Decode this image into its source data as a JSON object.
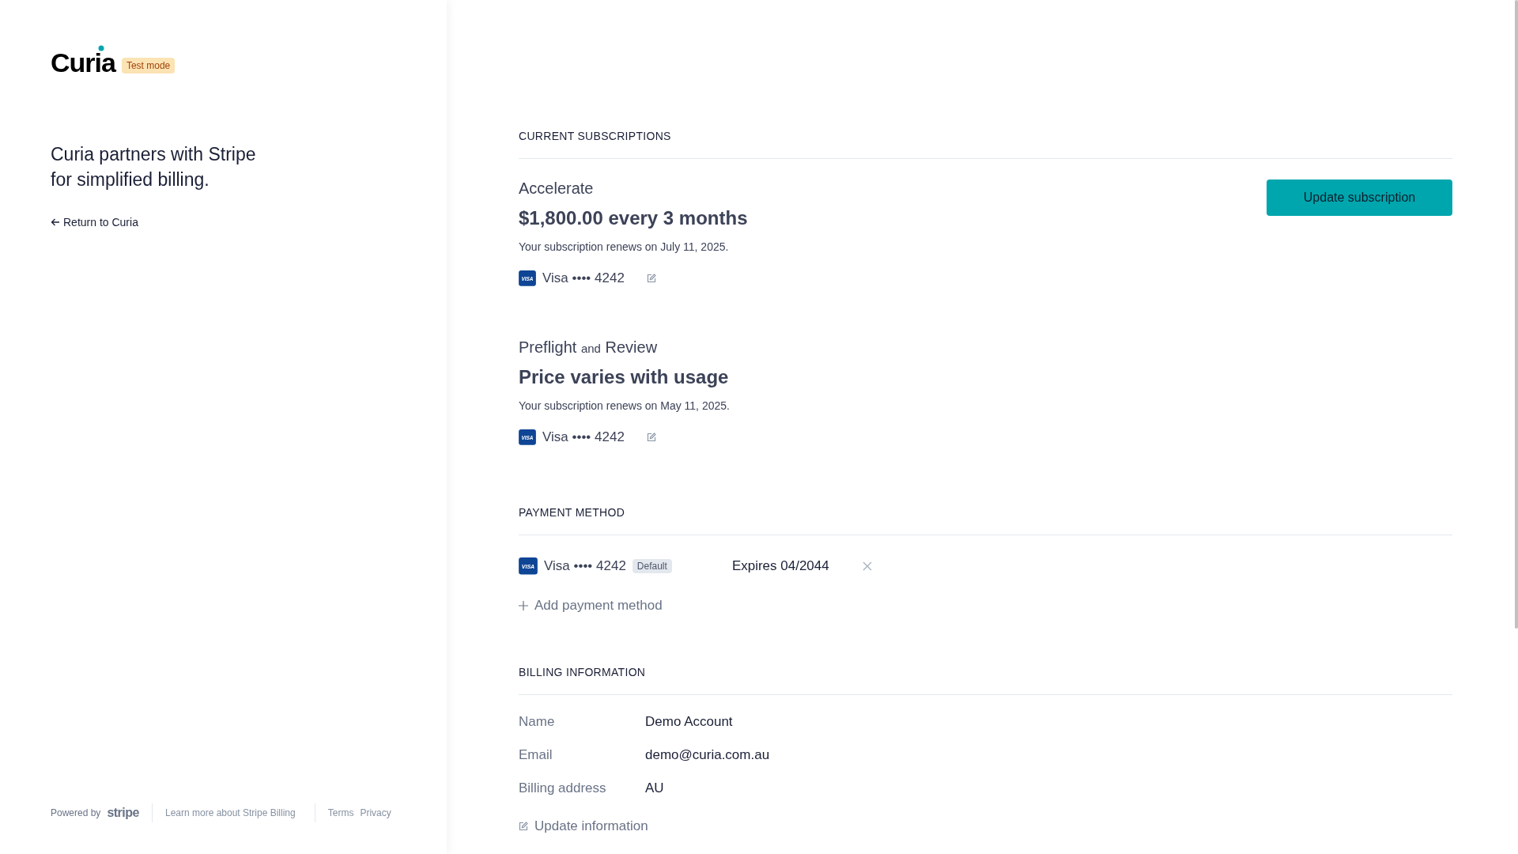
{
  "brand": {
    "logo": "Curia",
    "badge": "Test mode"
  },
  "tagline": "Curia partners with Stripe for simplified billing.",
  "return_link": "Return to Curia",
  "footer": {
    "powered_by": "Powered by",
    "stripe_logo": "stripe",
    "links": [
      "Learn more about Stripe Billing",
      "Terms",
      "Privacy"
    ]
  },
  "subscriptions": {
    "heading": "CURRENT SUBSCRIPTIONS",
    "update_button": "Update subscription",
    "items": [
      {
        "name_parts": [
          {
            "text": "Accelerate",
            "kind": "word"
          }
        ],
        "price": "$1,800.00 every 3 months",
        "renewal": "Your subscription renews on July 11, 2025.",
        "card": {
          "brand": "VISA",
          "label": "Visa •••• 4242"
        }
      },
      {
        "name_parts": [
          {
            "text": "Preflight",
            "kind": "word"
          },
          {
            "text": "and",
            "kind": "joiner"
          },
          {
            "text": "Review",
            "kind": "word"
          }
        ],
        "price": "Price varies with usage",
        "renewal": "Your subscription renews on May 11, 2025.",
        "card": {
          "brand": "VISA",
          "label": "Visa •••• 4242"
        }
      }
    ]
  },
  "payment_method": {
    "heading": "PAYMENT METHOD",
    "methods": [
      {
        "brand": "VISA",
        "label": "Visa •••• 4242",
        "default_badge": "Default",
        "expires": "Expires 04/2044"
      }
    ],
    "add": "Add payment method"
  },
  "billing": {
    "heading": "BILLING INFORMATION",
    "fields": [
      {
        "label": "Name",
        "value": "Demo Account"
      },
      {
        "label": "Email",
        "value": "demo@curia.com.au"
      },
      {
        "label": "Billing address",
        "value": "AU"
      }
    ],
    "update": "Update information"
  }
}
